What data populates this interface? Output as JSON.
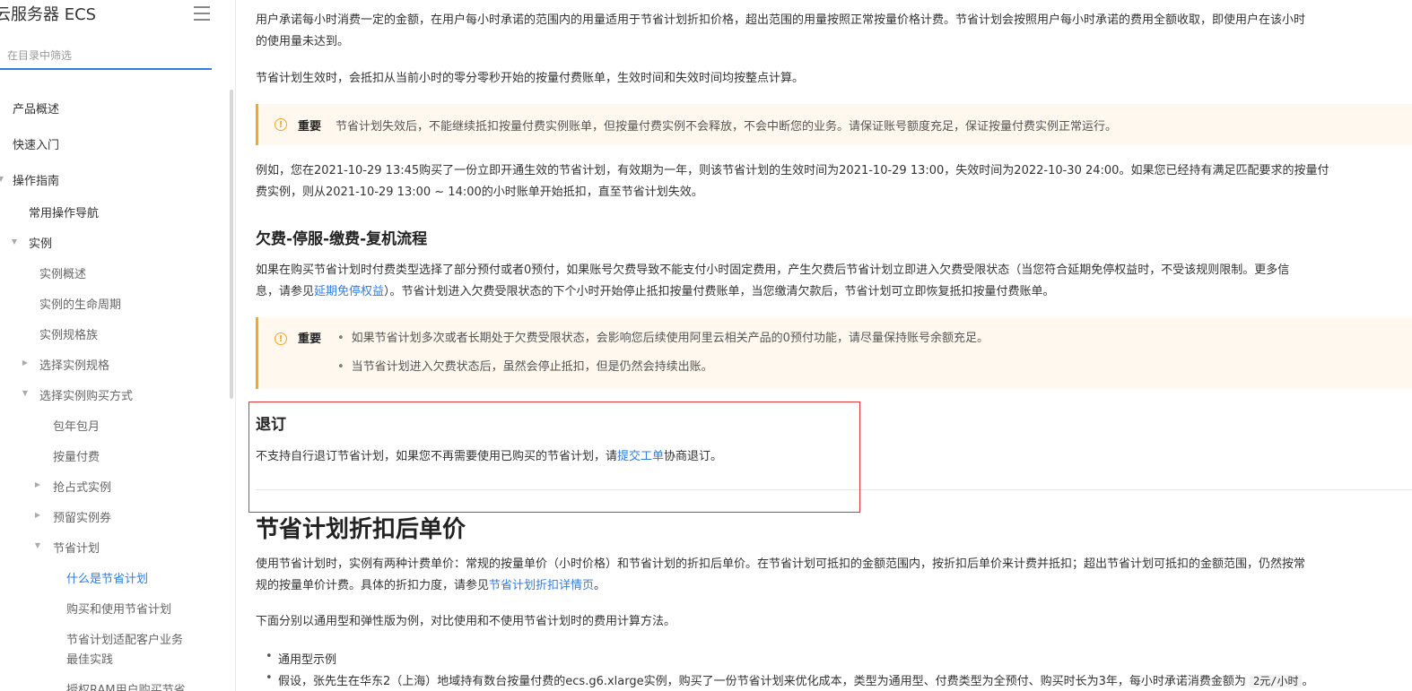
{
  "sidebar": {
    "title": "云服务器 ECS",
    "filter_placeholder": "在目录中筛选",
    "items": [
      {
        "label": "产品概述"
      },
      {
        "label": "快速入门"
      },
      {
        "label": "操作指南"
      },
      {
        "label": "常用操作导航"
      },
      {
        "label": "实例"
      },
      {
        "label": "实例概述"
      },
      {
        "label": "实例的生命周期"
      },
      {
        "label": "实例规格族"
      },
      {
        "label": "选择实例规格"
      },
      {
        "label": "选择实例购买方式"
      },
      {
        "label": "包年包月"
      },
      {
        "label": "按量付费"
      },
      {
        "label": "抢占式实例"
      },
      {
        "label": "预留实例券"
      },
      {
        "label": "节省计划"
      },
      {
        "label": "什么是节省计划"
      },
      {
        "label": "购买和使用节省计划"
      },
      {
        "label": "节省计划适配客户业务"
      },
      {
        "label": "最佳实践"
      },
      {
        "label": "授权RAM用户购买节省"
      }
    ]
  },
  "main": {
    "intro": {
      "line1": "用户承诺每小时消费一定的金额，在用户每小时承诺的范围内的用量适用于节省计划折扣价格，超出范围的用量按照正常按量价格计费。节省计划会按照用户每小时承诺的费用全额收取，即使用户在该小时",
      "line2": "的使用量未达到。"
    },
    "effect_para": "节省计划生效时，会抵扣从当前小时的零分零秒开始的按量付费账单，生效时间和失效时间均按整点计算。",
    "notice1": {
      "label": "重要",
      "text": "节省计划失效后，不能继续抵扣按量付费实例账单，但按量付费实例不会释放，不会中断您的业务。请保证账号额度充足，保证按量付费实例正常运行。"
    },
    "example": {
      "line1": "例如，您在2021-10-29 13:45购买了一份立即开通生效的节省计划，有效期为一年，则该节省计划的生效时间为2021-10-29 13:00，失效时间为2022-10-30 24:00。如果您已经持有满足匹配要求的按量付",
      "line2": "费实例，则从2021-10-29 13:00 ~ 14:00的小时账单开始抵扣，直至节省计划失效。"
    },
    "section_arrears": {
      "title": "欠费-停服-缴费-复机流程",
      "line1": "如果在购买节省计划时付费类型选择了部分预付或者0预付，如果账号欠费导致不能支付小时固定费用，产生欠费后节省计划立即进入欠费受限状态（当您符合延期免停权益时，不受该规则限制。更多信",
      "line2_pre": "息，请参见",
      "line2_link": "延期免停权益",
      "line2_post": "）。节省计划进入欠费受限状态的下个小时开始停止抵扣按量付费账单，当您缴清欠款后，节省计划可立即恢复抵扣按量付费账单。"
    },
    "notice2": {
      "label": "重要",
      "items": [
        "如果节省计划多次或者长期处于欠费受限状态，会影响您后续使用阿里云相关产品的0预付功能，请尽量保持账号余额充足。",
        "当节省计划进入欠费状态后，虽然会停止抵扣，但是仍然会持续出账。"
      ]
    },
    "section_refund": {
      "title": "退订",
      "text_pre": "不支持自行退订节省计划，如果您不再需要使用已购买的节省计划，请",
      "text_link": "提交工单",
      "text_post": "协商退订。"
    },
    "section_price": {
      "title": "节省计划折扣后单价",
      "line1": "使用节省计划时，实例有两种计费单价：常规的按量单价（小时价格）和节省计划的折扣后单价。在节省计划可抵扣的金额范围内，按折扣后单价来计费并抵扣；超出节省计划可抵扣的金额范围，仍然按常",
      "line2_pre": "规的按量单价计费。具体的折扣力度，请参见",
      "line2_link": "节省计划折扣详情页",
      "line2_post": "。",
      "para2": "下面分别以通用型和弹性版为例，对比使用和不使用节省计划时的费用计算方法。",
      "bullet1": "通用型示例",
      "bullet1_desc_pre": "假设，张先生在华东2（上海）地域持有数台按量付费的ecs.g6.xlarge实例，购买了一份节省计划来优化成本，类型为通用型、付费类型为全预付、购买时长为3年，每小时承诺消费金额为",
      "bullet1_code": "2元/小时",
      "bullet1_desc_post": "。"
    }
  },
  "colors": {
    "accent": "#2f7de1",
    "notice_bg": "#fff8ee",
    "notice_border": "#f5a623",
    "highlight_box": "#e0363a"
  }
}
